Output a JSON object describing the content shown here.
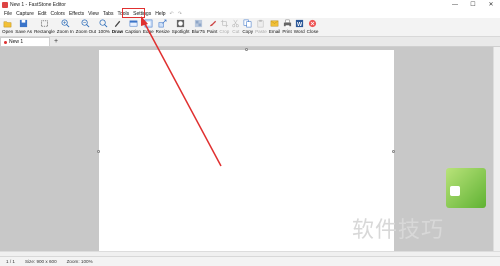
{
  "window": {
    "title": "New 1 - FastStone Editor",
    "controls": [
      "—",
      "☐",
      "✕"
    ]
  },
  "menu": {
    "items": [
      "File",
      "Capture",
      "Edit",
      "Colors",
      "Effects",
      "View",
      "Tabs",
      "Tools",
      "Settings",
      "Help"
    ],
    "undo_glyph": "↶",
    "redo_glyph": "↷",
    "highlighted": "Settings"
  },
  "toolbar": {
    "items": [
      {
        "label": "Open",
        "icon": "folder-icon"
      },
      {
        "label": "Save As",
        "icon": "save-icon"
      },
      {
        "label": "Rectangle",
        "icon": "rectangle-icon"
      },
      {
        "label": "Zoom In",
        "icon": "zoom-in-icon"
      },
      {
        "label": "Zoom Out",
        "icon": "zoom-out-icon"
      },
      {
        "label": "100%",
        "icon": "zoom-fit-icon"
      },
      {
        "label": "Draw",
        "icon": "draw-icon"
      },
      {
        "label": "Caption",
        "icon": "caption-icon"
      },
      {
        "label": "Edge",
        "icon": "edge-icon"
      },
      {
        "label": "Resize",
        "icon": "resize-icon"
      },
      {
        "label": "Spotlight",
        "icon": "spotlight-icon"
      },
      {
        "label": "Blur75",
        "icon": "blur-icon"
      },
      {
        "label": "Paint",
        "icon": "paint-icon"
      },
      {
        "label": "Crop",
        "icon": "crop-icon"
      },
      {
        "label": "Cut",
        "icon": "cut-icon"
      },
      {
        "label": "Copy",
        "icon": "copy-icon"
      },
      {
        "label": "Paste",
        "icon": "paste-icon"
      },
      {
        "label": "Email",
        "icon": "email-icon"
      },
      {
        "label": "Print",
        "icon": "print-icon"
      },
      {
        "label": "Word",
        "icon": "word-icon"
      },
      {
        "label": "Close",
        "icon": "close-icon"
      }
    ]
  },
  "tabs": {
    "items": [
      {
        "label": "New 1"
      }
    ],
    "add_glyph": "+"
  },
  "status": {
    "page": "1 / 1",
    "size": "Size: 900 x 600",
    "zoom": "Zoom: 100%"
  },
  "watermark": {
    "text": "软件技巧"
  },
  "colors": {
    "highlight": "#e03030",
    "workspace": "#c8c8c8"
  }
}
